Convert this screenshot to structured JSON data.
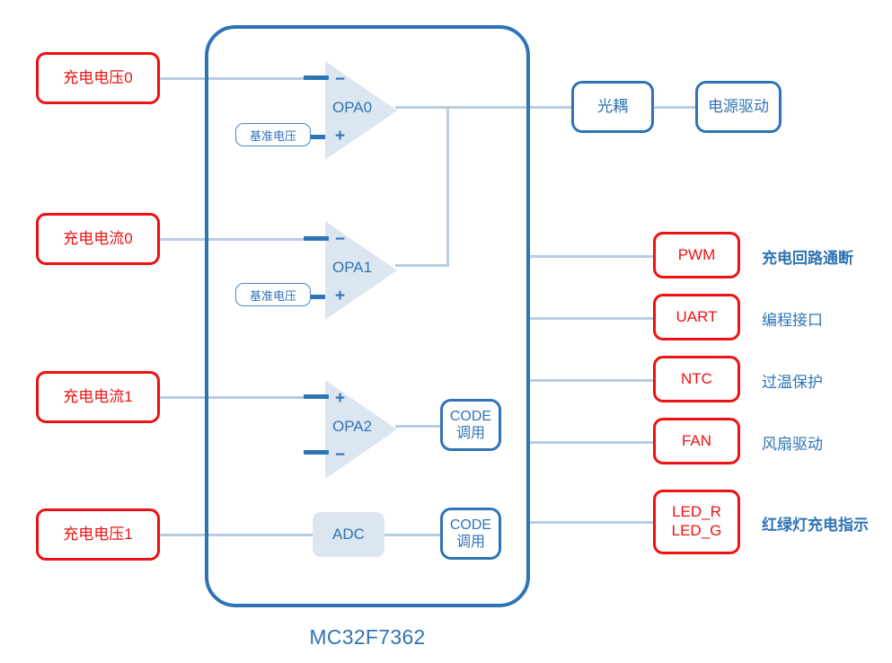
{
  "chip": {
    "title": "MC32F7362",
    "label": "mcu-chip"
  },
  "inputs": [
    {
      "label": "充电电压0"
    },
    {
      "label": "充电电流0"
    },
    {
      "label": "充电电流1"
    },
    {
      "label": "充电电压1"
    }
  ],
  "reference": [
    {
      "label": "基准电压"
    },
    {
      "label": "基准电压"
    }
  ],
  "opamps": [
    {
      "name": "OPA0",
      "top_sign": "−",
      "bottom_sign": "+"
    },
    {
      "name": "OPA1",
      "top_sign": "−",
      "bottom_sign": "+"
    },
    {
      "name": "OPA2",
      "top_sign": "+",
      "bottom_sign": "−"
    }
  ],
  "blocks": {
    "adc": "ADC",
    "code_call_1": {
      "line1": "CODE",
      "line2": "调用"
    },
    "code_call_2": {
      "line1": "CODE",
      "line2": "调用"
    }
  },
  "drive_chain": [
    {
      "label": "光耦"
    },
    {
      "label": "电源驱动"
    }
  ],
  "peripherals": [
    {
      "name": "PWM",
      "desc": "充电回路通断",
      "bold": true
    },
    {
      "name": "UART",
      "desc": "编程接口",
      "bold": false
    },
    {
      "name": "NTC",
      "desc": "过温保护",
      "bold": false
    },
    {
      "name": "FAN",
      "desc": "风扇驱动",
      "bold": false
    },
    {
      "name_line1": "LED_R",
      "name_line2": "LED_G",
      "desc": "红绿灯充电指示",
      "bold": true
    }
  ],
  "colors": {
    "red": "#ee1111",
    "blue": "#2e74b5",
    "wire": "#b8cce4",
    "fill_light": "#dce6f1"
  }
}
